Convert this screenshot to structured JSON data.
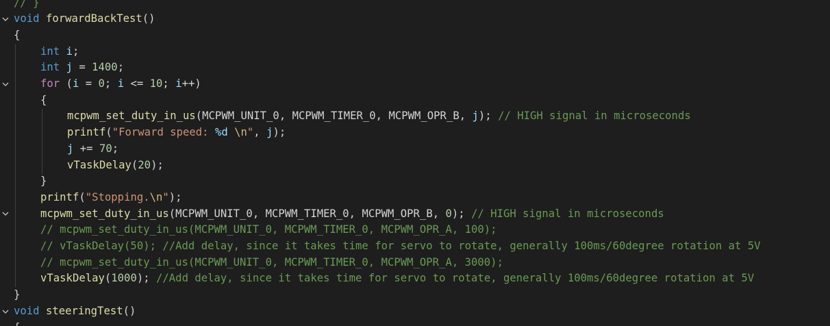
{
  "editor": {
    "language": "C",
    "theme_colors": {
      "background": "#1e1e1e",
      "keyword": "#569cd6",
      "control": "#c586c0",
      "function": "#dcdcaa",
      "variable": "#9cdcfe",
      "number": "#b5cea8",
      "string": "#ce9178",
      "comment": "#6a9955",
      "text": "#d4d4d4"
    },
    "lines": [
      {
        "fold": false,
        "indent": 0,
        "tokens": [
          {
            "t": "// }",
            "c": "cm"
          }
        ]
      },
      {
        "fold": true,
        "indent": 0,
        "tokens": [
          {
            "t": "void",
            "c": "kw"
          },
          {
            "t": " ",
            "c": "pl"
          },
          {
            "t": "forwardBackTest",
            "c": "fn"
          },
          {
            "t": "()",
            "c": "pl"
          }
        ]
      },
      {
        "fold": false,
        "indent": 0,
        "tokens": [
          {
            "t": "{",
            "c": "pl"
          }
        ]
      },
      {
        "fold": false,
        "indent": 1,
        "tokens": [
          {
            "t": "int",
            "c": "kw"
          },
          {
            "t": " ",
            "c": "pl"
          },
          {
            "t": "i",
            "c": "var"
          },
          {
            "t": ";",
            "c": "pl"
          }
        ]
      },
      {
        "fold": false,
        "indent": 1,
        "tokens": [
          {
            "t": "int",
            "c": "kw"
          },
          {
            "t": " ",
            "c": "pl"
          },
          {
            "t": "j",
            "c": "var"
          },
          {
            "t": " = ",
            "c": "pl"
          },
          {
            "t": "1400",
            "c": "num"
          },
          {
            "t": ";",
            "c": "pl"
          }
        ]
      },
      {
        "fold": true,
        "indent": 1,
        "tokens": [
          {
            "t": "for",
            "c": "ctl"
          },
          {
            "t": " (",
            "c": "pl"
          },
          {
            "t": "i",
            "c": "var"
          },
          {
            "t": " = ",
            "c": "pl"
          },
          {
            "t": "0",
            "c": "num"
          },
          {
            "t": "; ",
            "c": "pl"
          },
          {
            "t": "i",
            "c": "var"
          },
          {
            "t": " <= ",
            "c": "pl"
          },
          {
            "t": "10",
            "c": "num"
          },
          {
            "t": "; ",
            "c": "pl"
          },
          {
            "t": "i",
            "c": "var"
          },
          {
            "t": "++)",
            "c": "pl"
          }
        ]
      },
      {
        "fold": false,
        "indent": 1,
        "tokens": [
          {
            "t": "{",
            "c": "pl"
          }
        ]
      },
      {
        "fold": false,
        "indent": 2,
        "tokens": [
          {
            "t": "mcpwm_set_duty_in_us",
            "c": "fn"
          },
          {
            "t": "(",
            "c": "pl"
          },
          {
            "t": "MCPWM_UNIT_0",
            "c": "en"
          },
          {
            "t": ", ",
            "c": "pl"
          },
          {
            "t": "MCPWM_TIMER_0",
            "c": "en"
          },
          {
            "t": ", ",
            "c": "pl"
          },
          {
            "t": "MCPWM_OPR_B",
            "c": "en"
          },
          {
            "t": ", ",
            "c": "pl"
          },
          {
            "t": "j",
            "c": "var"
          },
          {
            "t": "); ",
            "c": "pl"
          },
          {
            "t": "// HIGH signal in microseconds",
            "c": "cm"
          }
        ]
      },
      {
        "fold": false,
        "indent": 2,
        "tokens": [
          {
            "t": "printf",
            "c": "fn"
          },
          {
            "t": "(",
            "c": "pl"
          },
          {
            "t": "\"Forward speed: ",
            "c": "str"
          },
          {
            "t": "%d",
            "c": "var"
          },
          {
            "t": " ",
            "c": "str"
          },
          {
            "t": "\\n",
            "c": "esc"
          },
          {
            "t": "\"",
            "c": "str"
          },
          {
            "t": ", ",
            "c": "pl"
          },
          {
            "t": "j",
            "c": "var"
          },
          {
            "t": ");",
            "c": "pl"
          }
        ]
      },
      {
        "fold": false,
        "indent": 2,
        "tokens": [
          {
            "t": "j",
            "c": "var"
          },
          {
            "t": " += ",
            "c": "pl"
          },
          {
            "t": "70",
            "c": "num"
          },
          {
            "t": ";",
            "c": "pl"
          }
        ]
      },
      {
        "fold": false,
        "indent": 2,
        "tokens": [
          {
            "t": "vTaskDelay",
            "c": "fn"
          },
          {
            "t": "(",
            "c": "pl"
          },
          {
            "t": "20",
            "c": "num"
          },
          {
            "t": ");",
            "c": "pl"
          }
        ]
      },
      {
        "fold": false,
        "indent": 1,
        "tokens": [
          {
            "t": "}",
            "c": "pl"
          }
        ]
      },
      {
        "fold": false,
        "indent": 1,
        "tokens": [
          {
            "t": "printf",
            "c": "fn"
          },
          {
            "t": "(",
            "c": "pl"
          },
          {
            "t": "\"Stopping.",
            "c": "str"
          },
          {
            "t": "\\n",
            "c": "esc"
          },
          {
            "t": "\"",
            "c": "str"
          },
          {
            "t": ");",
            "c": "pl"
          }
        ]
      },
      {
        "fold": true,
        "indent": 1,
        "tokens": [
          {
            "t": "mcpwm_set_duty_in_us",
            "c": "fn"
          },
          {
            "t": "(",
            "c": "pl"
          },
          {
            "t": "MCPWM_UNIT_0",
            "c": "en"
          },
          {
            "t": ", ",
            "c": "pl"
          },
          {
            "t": "MCPWM_TIMER_0",
            "c": "en"
          },
          {
            "t": ", ",
            "c": "pl"
          },
          {
            "t": "MCPWM_OPR_B",
            "c": "en"
          },
          {
            "t": ", ",
            "c": "pl"
          },
          {
            "t": "0",
            "c": "num"
          },
          {
            "t": "); ",
            "c": "pl"
          },
          {
            "t": "// HIGH signal in microseconds",
            "c": "cm"
          }
        ]
      },
      {
        "fold": false,
        "indent": 1,
        "tokens": [
          {
            "t": "// mcpwm_set_duty_in_us(MCPWM_UNIT_0, MCPWM_TIMER_0, MCPWM_OPR_A, 100);",
            "c": "cm"
          }
        ]
      },
      {
        "fold": false,
        "indent": 1,
        "tokens": [
          {
            "t": "// vTaskDelay(50); //Add delay, since it takes time for servo to rotate, generally 100ms/60degree rotation at 5V",
            "c": "cm"
          }
        ]
      },
      {
        "fold": false,
        "indent": 1,
        "tokens": [
          {
            "t": "// mcpwm_set_duty_in_us(MCPWM_UNIT_0, MCPWM_TIMER_0, MCPWM_OPR_A, 3000);",
            "c": "cm"
          }
        ]
      },
      {
        "fold": false,
        "indent": 1,
        "tokens": [
          {
            "t": "vTaskDelay",
            "c": "fn"
          },
          {
            "t": "(",
            "c": "pl"
          },
          {
            "t": "1000",
            "c": "num"
          },
          {
            "t": "); ",
            "c": "pl"
          },
          {
            "t": "//Add delay, since it takes time for servo to rotate, generally 100ms/60degree rotation at 5V",
            "c": "cm"
          }
        ]
      },
      {
        "fold": false,
        "indent": 0,
        "tokens": [
          {
            "t": "}",
            "c": "pl"
          }
        ]
      },
      {
        "fold": true,
        "indent": 0,
        "tokens": [
          {
            "t": "void",
            "c": "kw"
          },
          {
            "t": " ",
            "c": "pl"
          },
          {
            "t": "steeringTest",
            "c": "fn"
          },
          {
            "t": "()",
            "c": "pl"
          }
        ]
      },
      {
        "fold": false,
        "indent": 0,
        "tokens": [
          {
            "t": "{",
            "c": "pl"
          }
        ]
      }
    ]
  }
}
